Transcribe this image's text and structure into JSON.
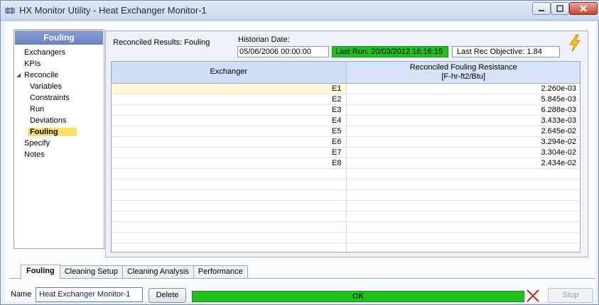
{
  "window": {
    "title": "HX Monitor Utility - Heat Exchanger Monitor-1"
  },
  "nav": {
    "header": "Fouling",
    "items": [
      {
        "label": "Exchangers",
        "level": 0
      },
      {
        "label": "KPIs",
        "level": 0
      },
      {
        "label": "Reconcile",
        "level": 0,
        "expanded": true
      },
      {
        "label": "Variables",
        "level": 1
      },
      {
        "label": "Constraints",
        "level": 1
      },
      {
        "label": "Run",
        "level": 1
      },
      {
        "label": "Deviations",
        "level": 1
      },
      {
        "label": "Fouling",
        "level": 1,
        "selected": true
      },
      {
        "label": "Specify",
        "level": 0
      },
      {
        "label": "Notes",
        "level": 0
      }
    ]
  },
  "panel": {
    "results_label": "Reconciled Results: Fouling",
    "historian_label": "Historian Date:",
    "historian_value": "05/06/2006 00:00:00",
    "last_run": "Last Run: 20/03/2012 16:16:15",
    "last_objective": "Last Rec Objective: 1.84"
  },
  "table": {
    "col1_header": "Exchanger",
    "col2_header_line1": "Reconciled Fouling Resistance",
    "col2_header_line2": "[F-hr-ft2/Btu]",
    "rows": [
      {
        "exchanger": "E1",
        "value": "2.260e-03"
      },
      {
        "exchanger": "E2",
        "value": "5.845e-03"
      },
      {
        "exchanger": "E3",
        "value": "6.288e-03"
      },
      {
        "exchanger": "E4",
        "value": "3.433e-03"
      },
      {
        "exchanger": "E5",
        "value": "2.645e-02"
      },
      {
        "exchanger": "E6",
        "value": "3.294e-02"
      },
      {
        "exchanger": "E7",
        "value": "3.304e-02"
      },
      {
        "exchanger": "E8",
        "value": "2.434e-02"
      }
    ]
  },
  "tabs": [
    {
      "label": "Fouling",
      "active": true
    },
    {
      "label": "Cleaning Setup"
    },
    {
      "label": "Cleaning Analysis"
    },
    {
      "label": "Performance"
    }
  ],
  "bottom": {
    "name_label": "Name",
    "name_value": "Heat Exchanger Monitor-1",
    "delete_label": "Delete",
    "status": "OK",
    "stop_label": "Stop"
  },
  "colors": {
    "status_green": "#1fc11f",
    "selected_yellow": "#ffe066",
    "nav_header": "#7a90cf"
  },
  "icons": [
    "app-icon",
    "minimize-icon",
    "maximize-icon",
    "close-icon",
    "lightning-icon",
    "expander-icon",
    "cancel-x-icon"
  ]
}
